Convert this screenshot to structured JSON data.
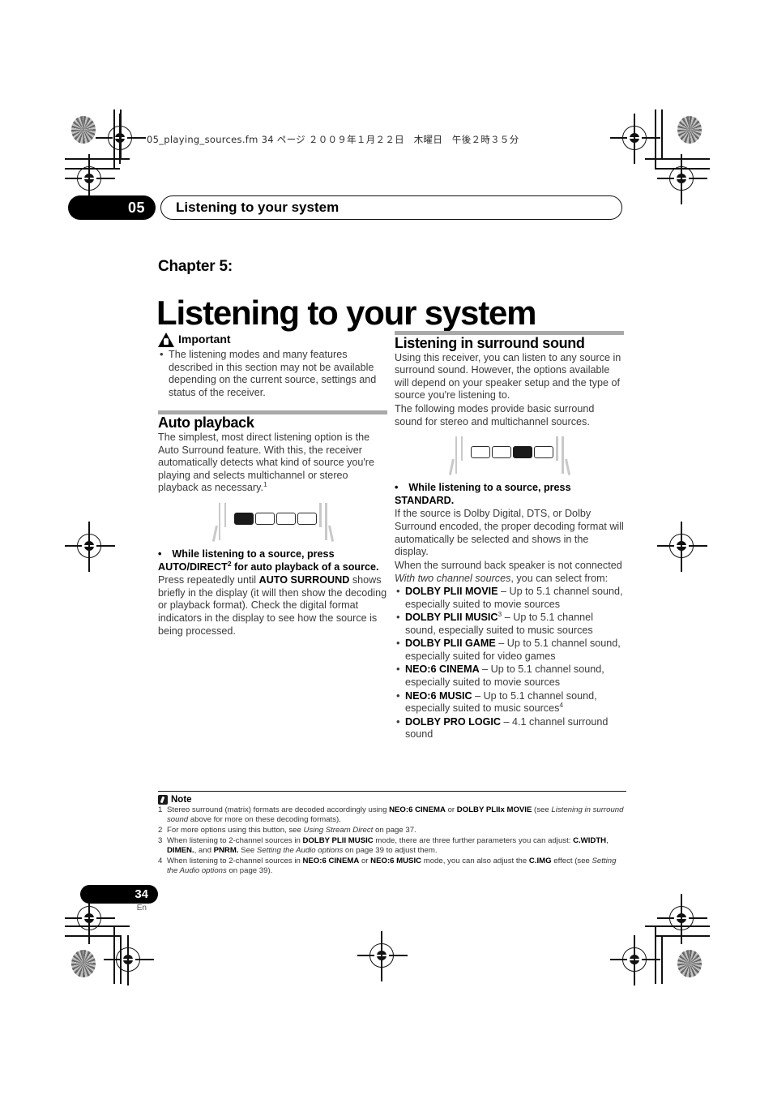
{
  "print_header": {
    "filename_line": "05_playing_sources.fm  34 ページ  ２００９年１月２２日　木曜日　午後２時３５分"
  },
  "running_header": {
    "chapter_number": "05",
    "chapter_title": "Listening to your system"
  },
  "title_block": {
    "chapter_label": "Chapter 5:",
    "title": "Listening to your system"
  },
  "left_column": {
    "important": {
      "icon": "warning-triangle-icon",
      "heading": "Important",
      "bullets": [
        "The listening modes and many features described in this section may not be available depending on the current source, settings and status of the receiver."
      ]
    },
    "auto_playback": {
      "heading": "Auto playback",
      "intro": "The simplest, most direct listening option is the Auto Surround feature. With this, the receiver automatically detects what kind of source you're playing and selects multichannel or stereo playback as necessary.",
      "intro_footnote": "1",
      "remote_illustration": {
        "name": "remote-control-auto-direct",
        "button_count": 4,
        "highlighted_index": 0
      },
      "step_bullet": "•",
      "step_line1": "While listening to a source, press",
      "step_line2_pre": "AUTO/DIRECT",
      "step_line2_sup": "2",
      "step_line2_post": " for auto playback of a source.",
      "body_pre": "Press repeatedly until ",
      "body_bold": "AUTO SURROUND",
      "body_post": " shows briefly in the display (it will then show the decoding or playback format). Check the digital format indicators in the display to see how the source is being processed."
    }
  },
  "right_column": {
    "surround": {
      "heading": "Listening in surround sound",
      "para1": "Using this receiver, you can listen to any source in surround sound. However, the options available will depend on your speaker setup and the type of source you're listening to.",
      "para2": "The following modes provide basic surround sound for stereo and multichannel sources.",
      "remote_illustration": {
        "name": "remote-control-standard",
        "button_count": 4,
        "highlighted_index": 2
      },
      "step_bullet": "•",
      "step_line1": "While listening to a source, press",
      "step_line2": "STANDARD.",
      "body1": "If the source is Dolby Digital, DTS, or Dolby Surround encoded, the proper decoding format will automatically be selected and shows in the display.",
      "body2": "When the surround back speaker is not connected",
      "body3_italic": "With two channel sources",
      "body3_rest": ", you can select from:",
      "modes": [
        {
          "name": "DOLBY PLII MOVIE",
          "sup": "",
          "desc": " – Up to 5.1 channel sound, especially suited to movie sources",
          "desc_sup": ""
        },
        {
          "name": "DOLBY PLII MUSIC",
          "sup": "3",
          "desc": " – Up to 5.1 channel sound, especially suited to music sources",
          "desc_sup": ""
        },
        {
          "name": "DOLBY PLII GAME",
          "sup": "",
          "desc": " – Up to 5.1 channel sound, especially suited for video games",
          "desc_sup": ""
        },
        {
          "name": "NEO:6 CINEMA",
          "sup": "",
          "desc": " – Up to 5.1 channel sound, especially suited to movie sources",
          "desc_sup": ""
        },
        {
          "name": "NEO:6 MUSIC",
          "sup": "",
          "desc": " – Up to 5.1 channel sound, especially suited to music sources",
          "desc_sup": "4"
        },
        {
          "name": "DOLBY PRO LOGIC",
          "sup": "",
          "desc": " – 4.1 channel surround sound",
          "desc_sup": ""
        }
      ]
    }
  },
  "notes": {
    "icon": "note-pencil-icon",
    "heading": "Note",
    "items": [
      {
        "num": "1",
        "html": "Stereo surround (matrix) formats are decoded accordingly using <b>NEO:6 CINEMA</b> or <b>DOLBY PLIIx MOVIE</b> (see <i>Listening in surround sound</i> above for more on these decoding formats)."
      },
      {
        "num": "2",
        "html": "For more options using this button, see <i>Using Stream Direct</i> on page 37."
      },
      {
        "num": "3",
        "html": "When listening to 2-channel sources in <b>DOLBY PLII MUSIC</b> mode, there are three further parameters you can adjust: <b>C.WIDTH</b>, <b>DIMEN.</b>, and <b>PNRM.</b> See <i>Setting the Audio options</i> on page 39 to adjust them."
      },
      {
        "num": "4",
        "html": "When listening to 2-channel sources in <b>NEO:6 CINEMA</b> or <b>NEO:6 MUSIC</b> mode, you can also adjust the <b>C.IMG</b> effect (see <i>Setting the Audio options</i> on page 39)."
      }
    ]
  },
  "footer": {
    "page_number": "34",
    "language_code": "En"
  }
}
